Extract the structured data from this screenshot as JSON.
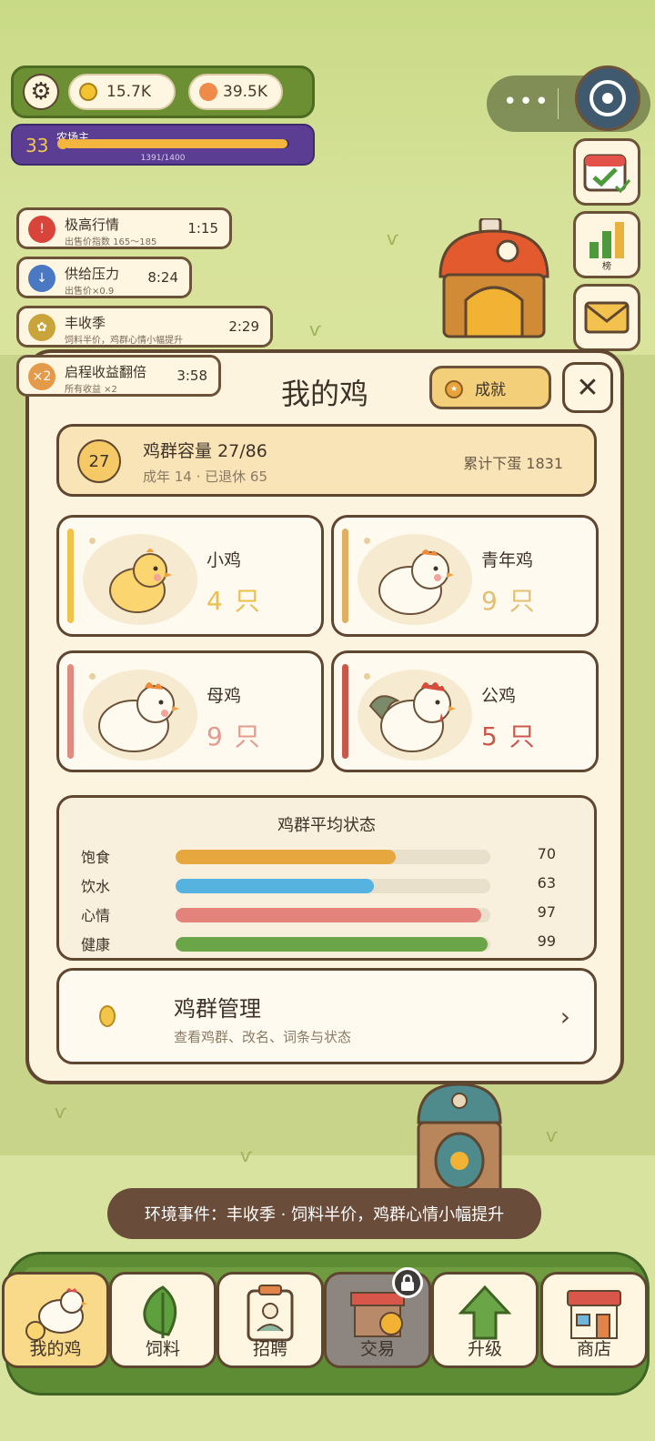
{
  "hud": {
    "coins": "15.7K",
    "gems": "39.5K",
    "level": "33",
    "role": "农场主",
    "xp_text": "1391/1400",
    "xp_ratio": 0.9936
  },
  "side": {
    "rank_label": "榜"
  },
  "events": [
    {
      "icon": "!",
      "title": "极高行情",
      "sub": "出售价指数 165～185",
      "time": "1:15",
      "color": "#d9443a"
    },
    {
      "icon": "↓",
      "title": "供给压力",
      "sub": "出售价×0.9",
      "time": "8:24",
      "color": "#4a78c2"
    },
    {
      "icon": "✿",
      "title": "丰收季",
      "sub": "饲料半价，鸡群心情小幅提升",
      "time": "2:29",
      "color": "#c8a43a"
    },
    {
      "icon": "×2",
      "title": "启程收益翻倍",
      "sub": "所有收益 ×2",
      "time": "3:58",
      "color": "#e59a4a"
    }
  ],
  "panel": {
    "title": "我的鸡",
    "achievement_label": "成就",
    "close_label": "✕",
    "capacity": {
      "badge": "27",
      "title": "鸡群容量 27/86",
      "sub": "成年 14 · 已退休 65",
      "eggs": "累计下蛋 1831"
    },
    "cards": [
      {
        "name": "小鸡",
        "count": "4 只",
        "stripe": "#f0c24a",
        "count_color": "#eabf4e"
      },
      {
        "name": "青年鸡",
        "count": "9 只",
        "stripe": "#e0b060",
        "count_color": "#e4bf72"
      },
      {
        "name": "母鸡",
        "count": "9 只",
        "stripe": "#e08b80",
        "count_color": "#e49a8f"
      },
      {
        "name": "公鸡",
        "count": "5 只",
        "stripe": "#c8594a",
        "count_color": "#c8594a"
      }
    ],
    "status": {
      "title": "鸡群平均状态",
      "rows": [
        {
          "label": "饱食",
          "value": 70,
          "display": "70",
          "color": "#e6a83e"
        },
        {
          "label": "饮水",
          "value": 63,
          "display": "63",
          "color": "#56b2de"
        },
        {
          "label": "心情",
          "value": 97,
          "display": "97",
          "color": "#e4837b"
        },
        {
          "label": "健康",
          "value": 99,
          "display": "99",
          "color": "#6aa548"
        }
      ]
    },
    "management": {
      "title": "鸡群管理",
      "sub": "查看鸡群、改名、词条与状态"
    }
  },
  "toast": "环境事件：丰收季 · 饲料半价，鸡群心情小幅提升",
  "nav": [
    {
      "label": "我的鸡"
    },
    {
      "label": "饲料"
    },
    {
      "label": "招聘"
    },
    {
      "label": "交易"
    },
    {
      "label": "升级"
    },
    {
      "label": "商店"
    }
  ]
}
